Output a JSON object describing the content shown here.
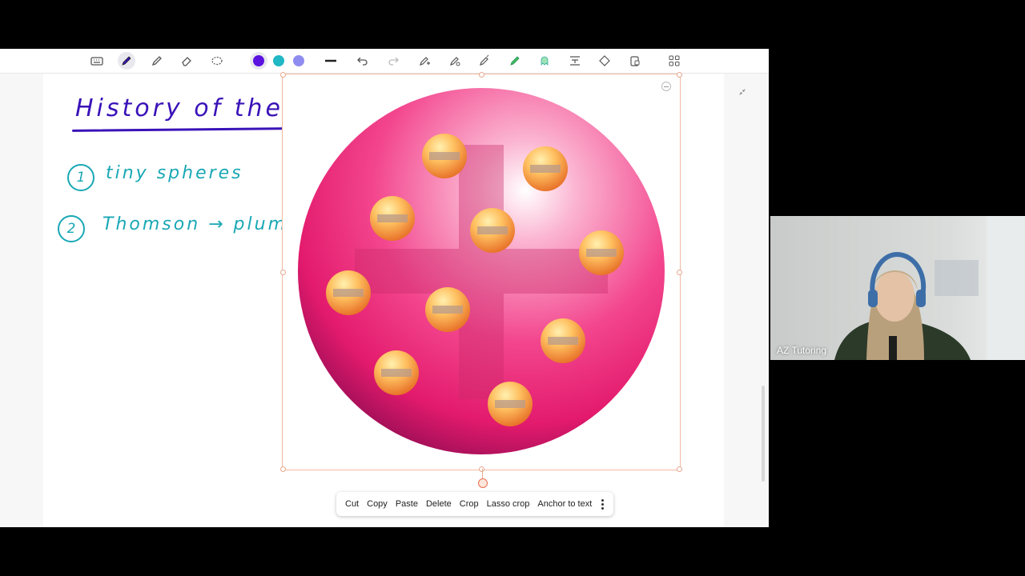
{
  "toolbar": {
    "tools": [
      {
        "name": "keyboard-icon",
        "active": false
      },
      {
        "name": "pen-icon",
        "active": true
      },
      {
        "name": "highlighter-icon",
        "active": false
      },
      {
        "name": "eraser-icon",
        "active": false
      },
      {
        "name": "lasso-icon",
        "active": false
      }
    ],
    "colors": [
      "#5b12e0",
      "#1fb8c4",
      "#8f8cf0"
    ],
    "actions": [
      {
        "name": "stroke-width-icon"
      },
      {
        "name": "undo-icon"
      },
      {
        "name": "redo-icon"
      },
      {
        "name": "pen-add-icon"
      },
      {
        "name": "pen-variant-icon"
      },
      {
        "name": "pen-nib-icon"
      },
      {
        "name": "marker-icon"
      },
      {
        "name": "shape-icon"
      },
      {
        "name": "text-insert-icon"
      },
      {
        "name": "shapes-icon"
      },
      {
        "name": "lock-icon"
      },
      {
        "name": "more-apps-icon"
      }
    ]
  },
  "notes": {
    "title": "History of the atom",
    "item1_number": "1",
    "item1_text": "tiny spheres",
    "item2_number": "2",
    "item2_text": "Thomson → plum"
  },
  "context_menu": {
    "items": [
      "Cut",
      "Copy",
      "Paste",
      "Delete",
      "Crop",
      "Lasso crop",
      "Anchor to text"
    ]
  },
  "video": {
    "participant": "AZ Tutoring"
  },
  "colors": {
    "title_ink": "#3a12b8",
    "note_ink": "#19a8b5",
    "selection": "#f3b9a1"
  }
}
